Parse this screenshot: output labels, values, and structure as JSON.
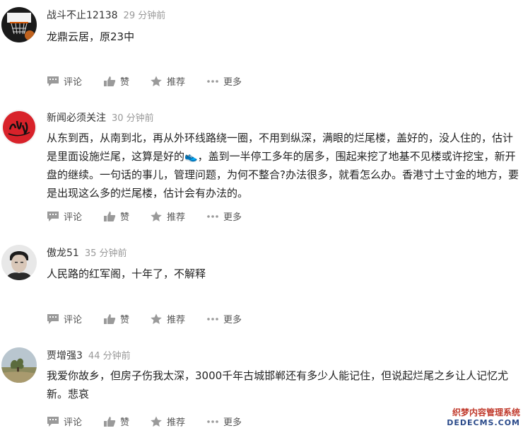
{
  "comments": [
    {
      "username": "战斗不止12138",
      "time": "29 分钟前",
      "text": "龙鼎云居，原23中",
      "avatar": "basketball-hoop-avatar"
    },
    {
      "username": "新闻必须关注",
      "time": "30 分钟前",
      "text": "从东到西，从南到北，再从外环线路绕一圈，不用到纵深，满眼的烂尾楼，盖好的，没人住的，估计是里面设施烂尾，这算是好的👟，盖到一半停工多年的居多，围起来挖了地基不见楼或许挖宝，新开盘的继续。一句话的事儿，管理问题，为何不整合?办法很多，就看怎么办。香港寸土寸金的地方，要是出现这么多的烂尾楼，估计会有办法的。",
      "avatar": "red-graffiti-avatar"
    },
    {
      "username": "傲龙51",
      "time": "35 分钟前",
      "text": "人民路的红军阁，十年了，不解释",
      "avatar": "portrait-avatar"
    },
    {
      "username": "贾增强3",
      "time": "44 分钟前",
      "text": "我爱你故乡，但房子伤我太深，3000千年古城邯郸还有多少人能记住，但说起烂尾之乡让人记忆尤新。悲哀",
      "avatar": "landscape-avatar"
    }
  ],
  "actions": {
    "comment": "评论",
    "like": "赞",
    "recommend": "推荐",
    "more": "更多"
  },
  "icons": {
    "comment": "comment-icon",
    "like": "thumbs-up-icon",
    "recommend": "star-icon",
    "more": "ellipsis-icon"
  },
  "colors": {
    "text": "#222222",
    "username": "#333333",
    "time": "#999999",
    "icon": "#9a9a9a"
  },
  "watermark": {
    "line1": "织梦内容管理系统",
    "line2": "DEDECMS.COM"
  }
}
